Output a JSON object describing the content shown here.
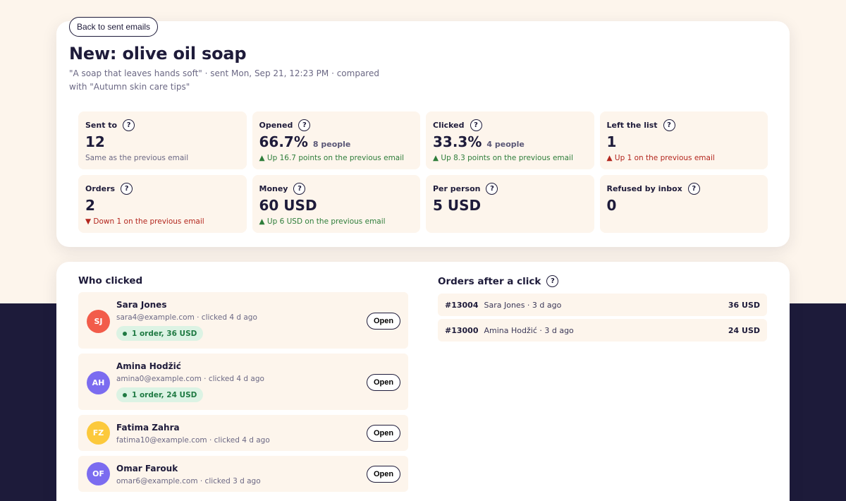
{
  "header": {
    "back_label": "Back to sent emails",
    "title": "New: olive oil soap",
    "subtitle": "\"A soap that leaves hands soft\" · sent Mon, Sep 21, 12:23 PM · compared with \"Autumn skin care tips\""
  },
  "help_glyph": "?",
  "stats": [
    {
      "label": "Sent to",
      "value": "12",
      "extra": "",
      "note": "Same as the previous email",
      "tone": "neutral"
    },
    {
      "label": "Opened",
      "value": "66.7%",
      "extra": "8 people",
      "note": "▲ Up 16.7 points on the previous email",
      "tone": "up"
    },
    {
      "label": "Clicked",
      "value": "33.3%",
      "extra": "4 people",
      "note": "▲ Up 8.3 points on the previous email",
      "tone": "up"
    },
    {
      "label": "Left the list",
      "value": "1",
      "extra": "",
      "note": "▲ Up 1 on the previous email",
      "tone": "bad"
    },
    {
      "label": "Orders",
      "value": "2",
      "extra": "",
      "note": "▼ Down 1 on the previous email",
      "tone": "bad"
    },
    {
      "label": "Money",
      "value": "60 USD",
      "extra": "",
      "note": "▲ Up 6 USD on the previous email",
      "tone": "up"
    },
    {
      "label": "Per person",
      "value": "5 USD",
      "extra": "",
      "note": "",
      "tone": "neutral"
    },
    {
      "label": "Refused by inbox",
      "value": "0",
      "extra": "",
      "note": "",
      "tone": "neutral"
    }
  ],
  "who_clicked": {
    "title": "Who clicked",
    "open_label": "Open",
    "people": [
      {
        "initials": "SJ",
        "name": "Sara Jones",
        "meta": "sara4@example.com · clicked 4 d ago",
        "badge": "1 order, 36 USD",
        "color": "#f25c4a"
      },
      {
        "initials": "AH",
        "name": "Amina Hodžić",
        "meta": "amina0@example.com · clicked 4 d ago",
        "badge": "1 order, 24 USD",
        "color": "#7b6cf0"
      },
      {
        "initials": "FZ",
        "name": "Fatima Zahra",
        "meta": "fatima10@example.com · clicked 4 d ago",
        "badge": "",
        "color": "#fcc93c"
      },
      {
        "initials": "OF",
        "name": "Omar Farouk",
        "meta": "omar6@example.com · clicked 3 d ago",
        "badge": "",
        "color": "#7b6cf0"
      }
    ]
  },
  "orders_after_click": {
    "title": "Orders after a click",
    "rows": [
      {
        "id": "#13004",
        "who": "Sara Jones · 3 d ago",
        "amount": "36 USD"
      },
      {
        "id": "#13000",
        "who": "Amina Hodžić · 3 d ago",
        "amount": "24 USD"
      }
    ]
  },
  "colors": {
    "ink": "#1e1b3a",
    "cream": "#fdf5ec",
    "dark_band": "#1d1b3a",
    "up_green": "#2e7d3a",
    "down_red": "#b3261e",
    "badge_green_bg": "#dcf3e4"
  }
}
